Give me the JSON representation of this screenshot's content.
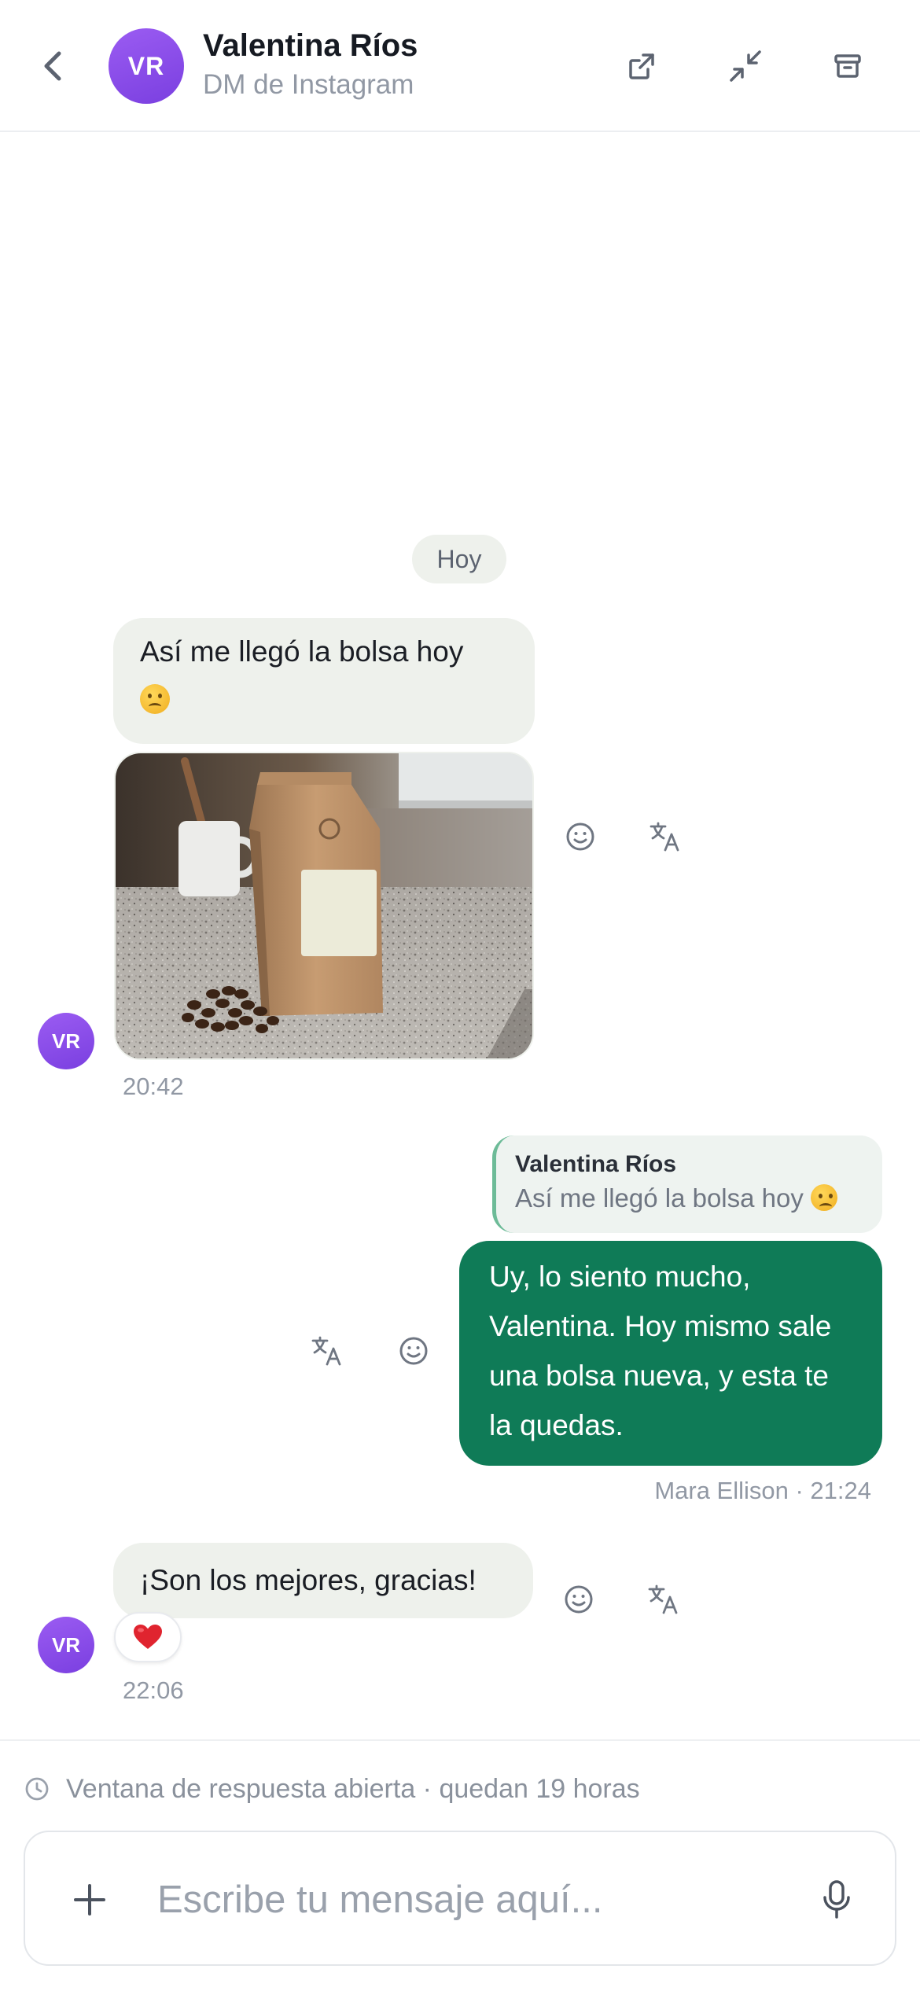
{
  "header": {
    "avatar_initials": "VR",
    "contact_name": "Valentina Ríos",
    "channel": "DM de Instagram",
    "icons": [
      "chevron-left-icon",
      "external-link-icon",
      "minimize-icon",
      "archive-icon"
    ]
  },
  "conversation": {
    "date_label": "Hoy",
    "messages": [
      {
        "direction": "incoming",
        "text": "Así me llegó la bolsa hoy",
        "emoji": "confused-face",
        "attachment": "photo-coffee-bag",
        "time": "20:42",
        "avatar_initials": "VR"
      },
      {
        "direction": "outgoing",
        "reply_to": {
          "name": "Valentina Ríos",
          "text": "Así me llegó la bolsa hoy"
        },
        "text": "Uy, lo siento mucho, Valentina. Hoy mismo sale una bolsa nueva, y esta te la quedas.",
        "meta": "Mara Ellison · 21:24"
      },
      {
        "direction": "incoming",
        "text": "¡Son los mejores, gracias!",
        "reaction": "heart",
        "time": "22:06",
        "avatar_initials": "VR"
      }
    ]
  },
  "footer": {
    "window_notice": "Ventana de respuesta abierta · quedan 19 horas",
    "composer_placeholder": "Escribe tu mensaje aquí..."
  },
  "colors": {
    "accent_outgoing": "#0f7b57",
    "incoming_bubble": "#eef1ec",
    "avatar": "#8b4ae8",
    "muted_text": "#9198a4"
  }
}
